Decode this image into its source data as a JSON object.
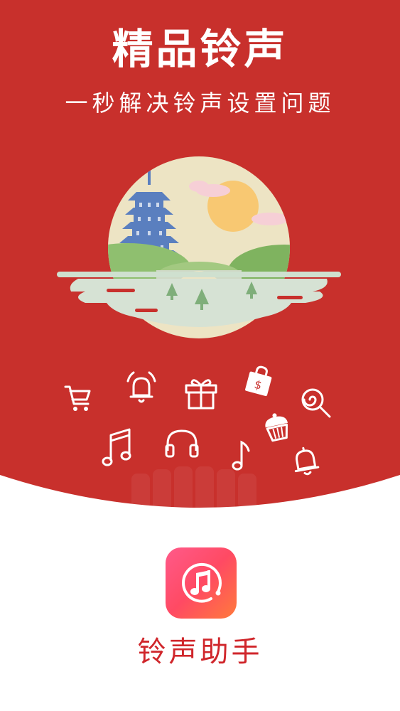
{
  "splash": {
    "title": "精品铃声",
    "subtitle": "一秒解决铃声设置问题",
    "app_name": "铃声助手"
  },
  "colors": {
    "brand_red": "#c8302c",
    "app_name_red": "#d0262b",
    "icon_gradient": [
      "#ff5a8a",
      "#ff7a3c"
    ]
  },
  "icons": [
    "shopping-cart-icon",
    "alarm-bell-icon",
    "gift-icon",
    "shopping-bag-icon",
    "lollipop-icon",
    "music-notes-icon",
    "headphones-icon",
    "music-note-icon",
    "cupcake-icon",
    "bell-icon",
    "app-music-icon"
  ]
}
